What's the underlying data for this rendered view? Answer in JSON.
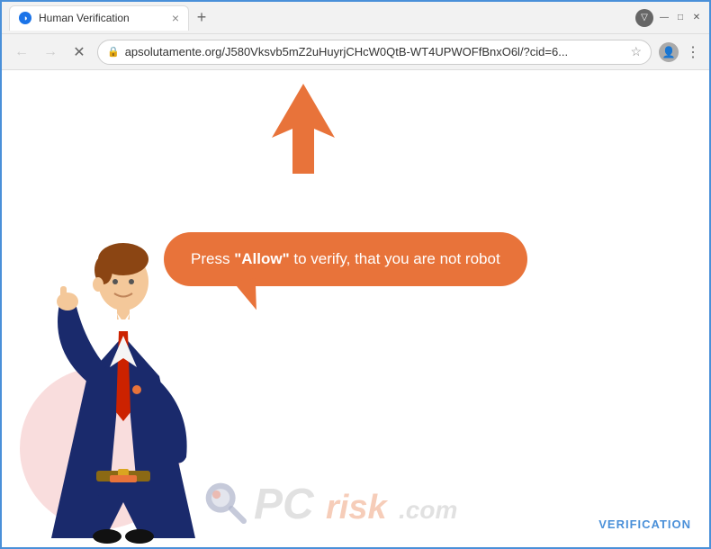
{
  "browser": {
    "tab": {
      "title": "Human Verification",
      "favicon_letter": "◑"
    },
    "close_btn": "×",
    "new_tab_btn": "+",
    "window_controls": {
      "minimize": "—",
      "maximize": "□",
      "close": "✕"
    },
    "extension_icon": "▽",
    "nav": {
      "back": "←",
      "forward": "→",
      "close": "✕"
    },
    "url": "apsolutamente.org/J580Vksvb5mZ2uHuyrjCHcW0QtB-WT4UPWOFfBnxO6l/?cid=6...",
    "star": "☆",
    "profile": "👤",
    "menu": "⋮"
  },
  "page": {
    "bubble_text_before": "Press ",
    "bubble_text_allow": "\"Allow\"",
    "bubble_text_after": " to verify, that you are not robot"
  },
  "watermark": {
    "pc": "PC",
    "separator": "risk",
    "com": ".com"
  },
  "verification_label": "VERIFICATION"
}
